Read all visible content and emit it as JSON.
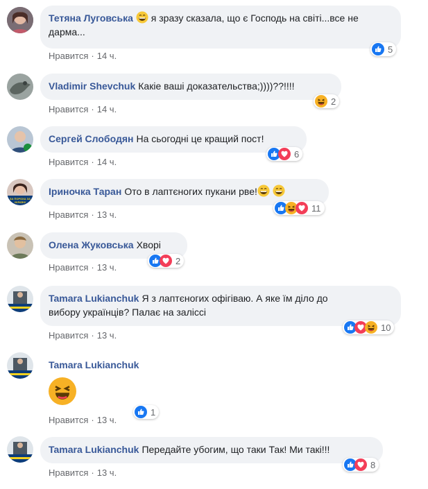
{
  "like_label": "Нравится",
  "comments": [
    {
      "author": "Тетяна Луговська",
      "text_after_emoji": " я зразу сказала, що є Господь на світі...все не дарма...",
      "time": "14 ч.",
      "reaction_count": "5"
    },
    {
      "author": "Vladimir Shevchuk",
      "text": "Какіе ваші доказательства;))))??!!!!",
      "time": "14 ч.",
      "reaction_count": "2"
    },
    {
      "author": "Сергей Слободян",
      "text": "На сьогодні це кращий пост!",
      "time": "14 ч.",
      "reaction_count": "6"
    },
    {
      "author": "Іриночка Таран",
      "text": "Ото в лаптєногих пукани рве!",
      "time": "13 ч.",
      "reaction_count": "11"
    },
    {
      "author": "Олена Жуковська",
      "text": "Хворі",
      "time": "13 ч.",
      "reaction_count": "2"
    },
    {
      "author": "Tamara Lukianchuk",
      "text_line1": "Я з лаптєногих офігіваю. А яке їм діло до",
      "text_line2": "вибору українців? Палає на заліссі",
      "time": "13 ч.",
      "reaction_count": "10"
    },
    {
      "author": "Tamara Lukianchuk",
      "text": "",
      "time": "13 ч.",
      "reaction_count": "1"
    },
    {
      "author": "Tamara Lukianchuk",
      "text": "Передайте убогим, що таки Так! Ми такі!!!",
      "time": "13 ч.",
      "reaction_count": "8"
    }
  ],
  "avatar_badge": "ЗА ПОРОХА ЗА УКРАЇНУ",
  "colors": {
    "name": "#385898",
    "bubble": "#f0f2f5",
    "meta": "#65676b",
    "like_blue": "#1877f2",
    "love_red": "#f33e58",
    "haha_yellow": "#f7b125"
  }
}
